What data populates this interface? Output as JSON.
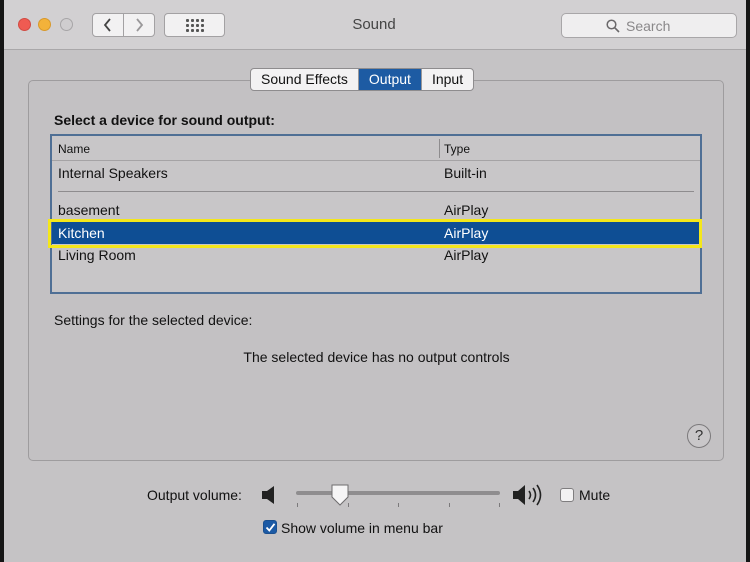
{
  "window": {
    "title": "Sound"
  },
  "search": {
    "placeholder": "Search"
  },
  "tabs": [
    {
      "label": "Sound Effects",
      "active": false
    },
    {
      "label": "Output",
      "active": true
    },
    {
      "label": "Input",
      "active": false
    }
  ],
  "output": {
    "select_label": "Select a device for sound output:",
    "columns": {
      "name": "Name",
      "type": "Type"
    },
    "devices": [
      {
        "name": "Internal Speakers",
        "type": "Built-in",
        "selected": false
      },
      {
        "name": "basement",
        "type": "AirPlay",
        "selected": false
      },
      {
        "name": "Kitchen",
        "type": "AirPlay",
        "selected": true
      },
      {
        "name": "Living Room",
        "type": "AirPlay",
        "selected": false
      }
    ],
    "settings_label": "Settings for the selected device:",
    "no_controls_text": "The selected device has no output controls",
    "help_symbol": "?"
  },
  "volume": {
    "label": "Output volume:",
    "level_fraction": 0.2,
    "mute_label": "Mute",
    "mute_checked": false,
    "show_in_menu_label": "Show volume in menu bar",
    "show_in_menu_checked": true
  },
  "colors": {
    "selection": "#0e4e94",
    "active_tab": "#1d5ba3",
    "highlight_border": "#f4e71a"
  },
  "icons": [
    "chevron-left-icon",
    "chevron-right-icon",
    "grid-icon",
    "search-icon",
    "speaker-low-icon",
    "speaker-high-icon",
    "help-icon",
    "checkmark-icon"
  ]
}
